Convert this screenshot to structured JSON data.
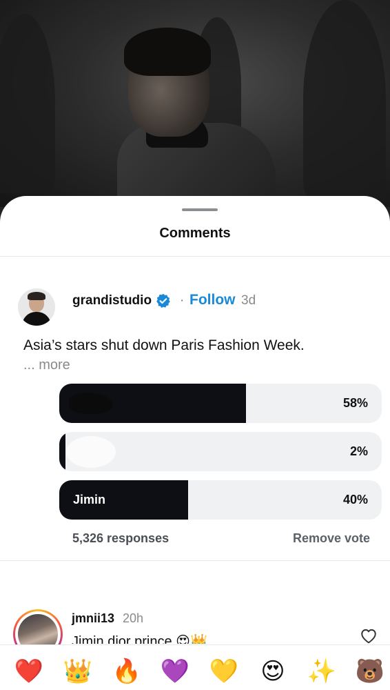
{
  "sheet": {
    "title": "Comments"
  },
  "post": {
    "username": "grandistudio",
    "follow_label": "Follow",
    "time": "3d",
    "caption": "Asia’s stars shut down Paris Fashion Week.",
    "more_label": "... more",
    "colors": {
      "follow": "#1a8ad8",
      "verified": "#1a8ad8"
    }
  },
  "poll": {
    "options": [
      {
        "label": "",
        "percent_label": "58%",
        "percent": 58
      },
      {
        "label": "",
        "percent_label": "2%",
        "percent": 2
      },
      {
        "label": "Jimin",
        "percent_label": "40%",
        "percent": 40
      }
    ],
    "responses": "5,326 responses",
    "remove_vote_label": "Remove vote"
  },
  "comment": {
    "username": "jmnii13",
    "time": "20h",
    "text": "Jimin dior prince 😍👑"
  },
  "emoji_bar": [
    {
      "name": "red-heart",
      "char": "❤️"
    },
    {
      "name": "crown",
      "char": "👑"
    },
    {
      "name": "fire",
      "char": "🔥"
    },
    {
      "name": "purple-heart",
      "char": "💜"
    },
    {
      "name": "yellow-heart",
      "char": "💛"
    },
    {
      "name": "heart-eyes",
      "char": "😍"
    },
    {
      "name": "sparkles",
      "char": "✨"
    },
    {
      "name": "bear",
      "char": "🐻"
    }
  ]
}
